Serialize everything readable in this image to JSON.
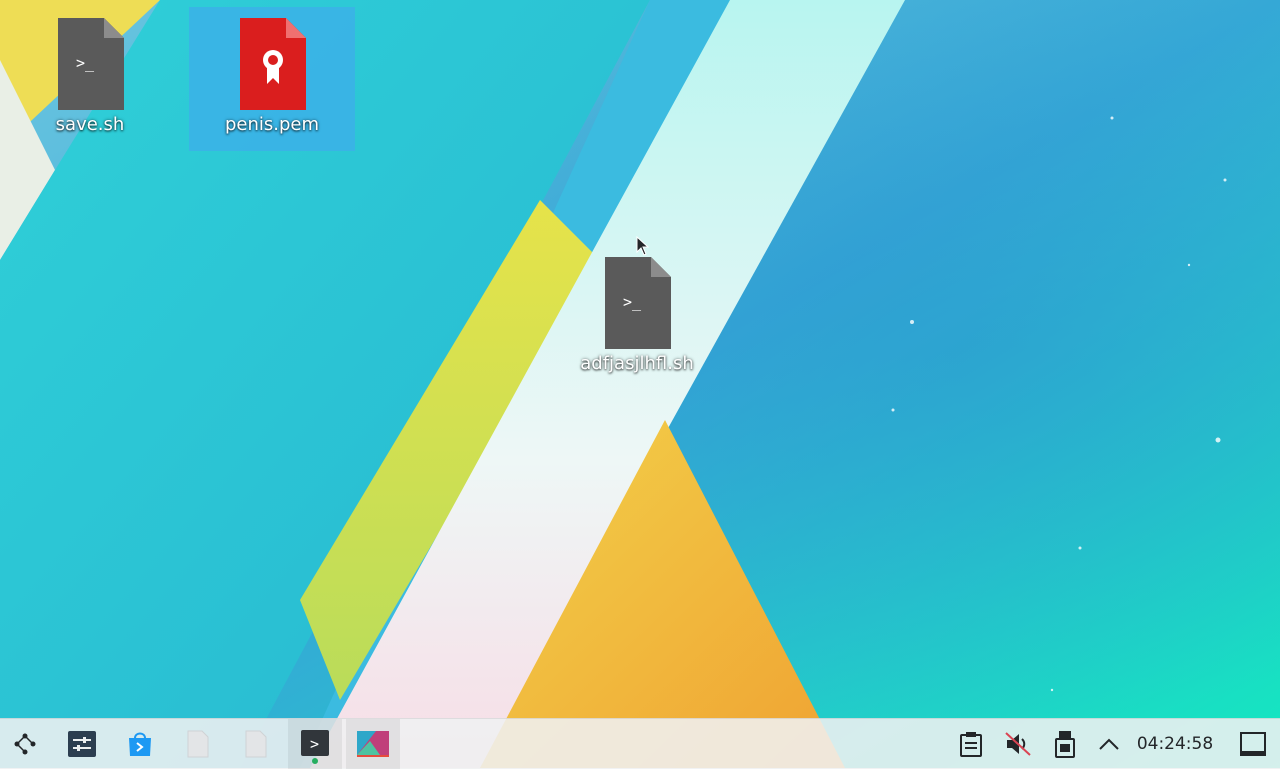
{
  "desktop": {
    "icons": [
      {
        "label": "save.sh",
        "type": "shell-script",
        "selected": false
      },
      {
        "label": "penis.pem",
        "type": "certificate",
        "selected": true
      },
      {
        "label": "adfjasjlhfl.sh",
        "type": "shell-script",
        "selected": false
      }
    ],
    "script_glyph": ">_"
  },
  "taskbar": {
    "launchers": [
      {
        "name": "application-launcher-icon"
      },
      {
        "name": "system-settings-icon"
      },
      {
        "name": "software-center-icon"
      },
      {
        "name": "blank-document-icon"
      },
      {
        "name": "blank-document-icon"
      },
      {
        "name": "terminal-icon"
      },
      {
        "name": "image-viewer-icon"
      }
    ],
    "terminal_glyph": ">",
    "tray": [
      {
        "name": "clipboard-icon"
      },
      {
        "name": "volume-muted-icon"
      },
      {
        "name": "removable-device-icon"
      },
      {
        "name": "chevron-up-icon"
      }
    ],
    "clock": "04:24:58"
  },
  "colors": {
    "selection": "#3daee9",
    "panel": "#eff0f1",
    "script_icon": "#5a5a5a",
    "cert_icon": "#da1e1e"
  }
}
